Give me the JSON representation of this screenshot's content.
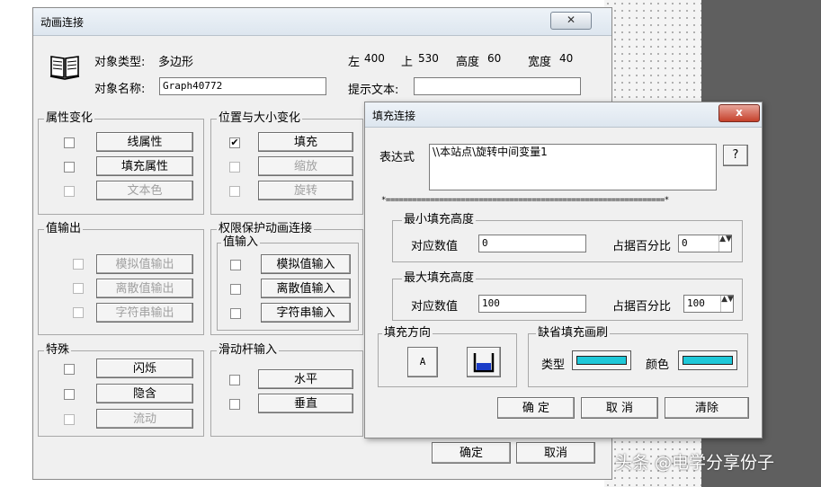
{
  "main": {
    "title": "动画连接",
    "close_glyph": "✕",
    "object_type_label": "对象类型:",
    "object_type_value": "多边形",
    "object_name_label": "对象名称:",
    "object_name_value": "Graph40772",
    "left_label": "左",
    "left_value": "400",
    "top_label": "上",
    "top_value": "530",
    "height_label": "高度",
    "height_value": "60",
    "width_label": "宽度",
    "width_value": "40",
    "tooltip_label": "提示文本:",
    "tooltip_value": "",
    "groups": {
      "attr_change": {
        "label": "属性变化",
        "buttons": [
          "线属性",
          "填充属性",
          "文本色"
        ]
      },
      "pos_size": {
        "label": "位置与大小变化",
        "buttons": [
          "填充",
          "缩放",
          "旋转"
        ]
      },
      "value_output": {
        "label": "值输出",
        "buttons": [
          "模拟值输出",
          "离散值输出",
          "字符串输出"
        ]
      },
      "perm": {
        "label": "权限保护动画连接",
        "sub_label": "值输入",
        "buttons": [
          "模拟值输入",
          "离散值输入",
          "字符串输入"
        ]
      },
      "special": {
        "label": "特殊",
        "buttons": [
          "闪烁",
          "隐含",
          "流动"
        ]
      },
      "slider": {
        "label": "滑动杆输入",
        "buttons": [
          "水平",
          "垂直"
        ]
      }
    },
    "checked_glyph": "✔",
    "ok_label": "确定",
    "cancel_label": "取消"
  },
  "fill": {
    "title": "填充连接",
    "close_glyph": "x",
    "expression_label": "表达式",
    "expression_value": "\\\\本站点\\旋转中间变量1",
    "help_label": "?",
    "separator": "*===============================================================*",
    "min_group_label": "最小填充高度",
    "min_value_label": "对应数值",
    "min_value": "0",
    "min_percent_label": "占据百分比",
    "min_percent": "0",
    "max_group_label": "最大填充高度",
    "max_value_label": "对应数值",
    "max_value": "100",
    "max_percent_label": "占据百分比",
    "max_percent": "100",
    "direction_label": "填充方向",
    "direction_a": "A",
    "brush_label": "缺省填充画刷",
    "type_label": "类型",
    "color_label": "颜色",
    "spin_glyphs": "▲▼",
    "ok_label": "确 定",
    "cancel_label": "取 消",
    "clear_label": "清除"
  },
  "watermark": "头条 @电学分享份子",
  "colors": {
    "swatch": "#1ec8d8",
    "fill_icon": "#1a3cc8"
  }
}
